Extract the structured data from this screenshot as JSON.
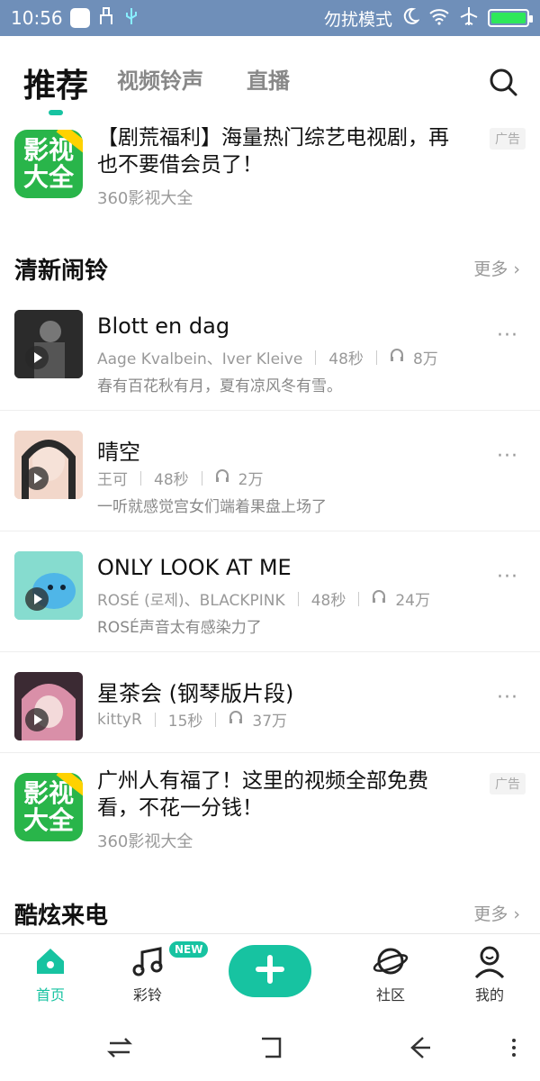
{
  "status_bar": {
    "time": "10:56",
    "right_text": "勿扰模式",
    "colors": {
      "background": "#6f8fb9",
      "battery_fill": "#2ee85a"
    }
  },
  "header": {
    "tabs": [
      {
        "label": "推荐",
        "active": true
      },
      {
        "label": "视频铃声",
        "active": false
      },
      {
        "label": "直播",
        "active": false
      }
    ],
    "accent_color": "#17c3a1"
  },
  "ads": [
    {
      "icon_text": [
        "影视",
        "大全"
      ],
      "title": "【剧荒福利】海量热门综艺电视剧，再也不要借会员了！",
      "source": "360影视大全",
      "tag": "广告"
    },
    {
      "icon_text": [
        "影视",
        "大全"
      ],
      "title": "广州人有福了！这里的视频全部免费看，不花一分钱！",
      "source": "360影视大全",
      "tag": "广告"
    }
  ],
  "sections": [
    {
      "title": "清新闹铃",
      "more": "更多"
    },
    {
      "title": "酷炫来电",
      "more": "更多"
    }
  ],
  "songs": [
    {
      "title": "Blott en dag",
      "artist": "Aage Kvalbein、Iver Kleive",
      "duration": "48秒",
      "plays": "8万",
      "desc": "春有百花秋有月，夏有凉风冬有雪。",
      "cover_color": "#3a3a3a"
    },
    {
      "title": "晴空",
      "artist": "王可",
      "duration": "48秒",
      "plays": "2万",
      "desc": "一听就感觉宫女们端着果盘上场了",
      "cover_color": "#e9c6b8"
    },
    {
      "title": "ONLY LOOK AT ME",
      "artist": "ROSÉ (로제)、BLACKPINK",
      "duration": "48秒",
      "plays": "24万",
      "desc": "ROSÉ声音太有感染力了",
      "cover_color": "#7fd3c8"
    },
    {
      "title": "星茶会 (钢琴版片段)",
      "artist": "kittyR",
      "duration": "15秒",
      "plays": "37万",
      "desc": "",
      "cover_color": "#b0788c"
    }
  ],
  "bottom_nav": {
    "items": [
      {
        "label": "首页",
        "icon": "home-icon",
        "active": true
      },
      {
        "label": "彩铃",
        "icon": "music-note-icon",
        "active": false
      },
      {
        "label": "",
        "icon": "plus-icon",
        "active": false
      },
      {
        "label": "社区",
        "icon": "planet-icon",
        "active": false
      },
      {
        "label": "我的",
        "icon": "user-icon",
        "active": false
      }
    ],
    "new_badge": "NEW"
  },
  "system_nav": [
    "switch-icon",
    "home-square-icon",
    "back-icon",
    "menu-icon"
  ]
}
